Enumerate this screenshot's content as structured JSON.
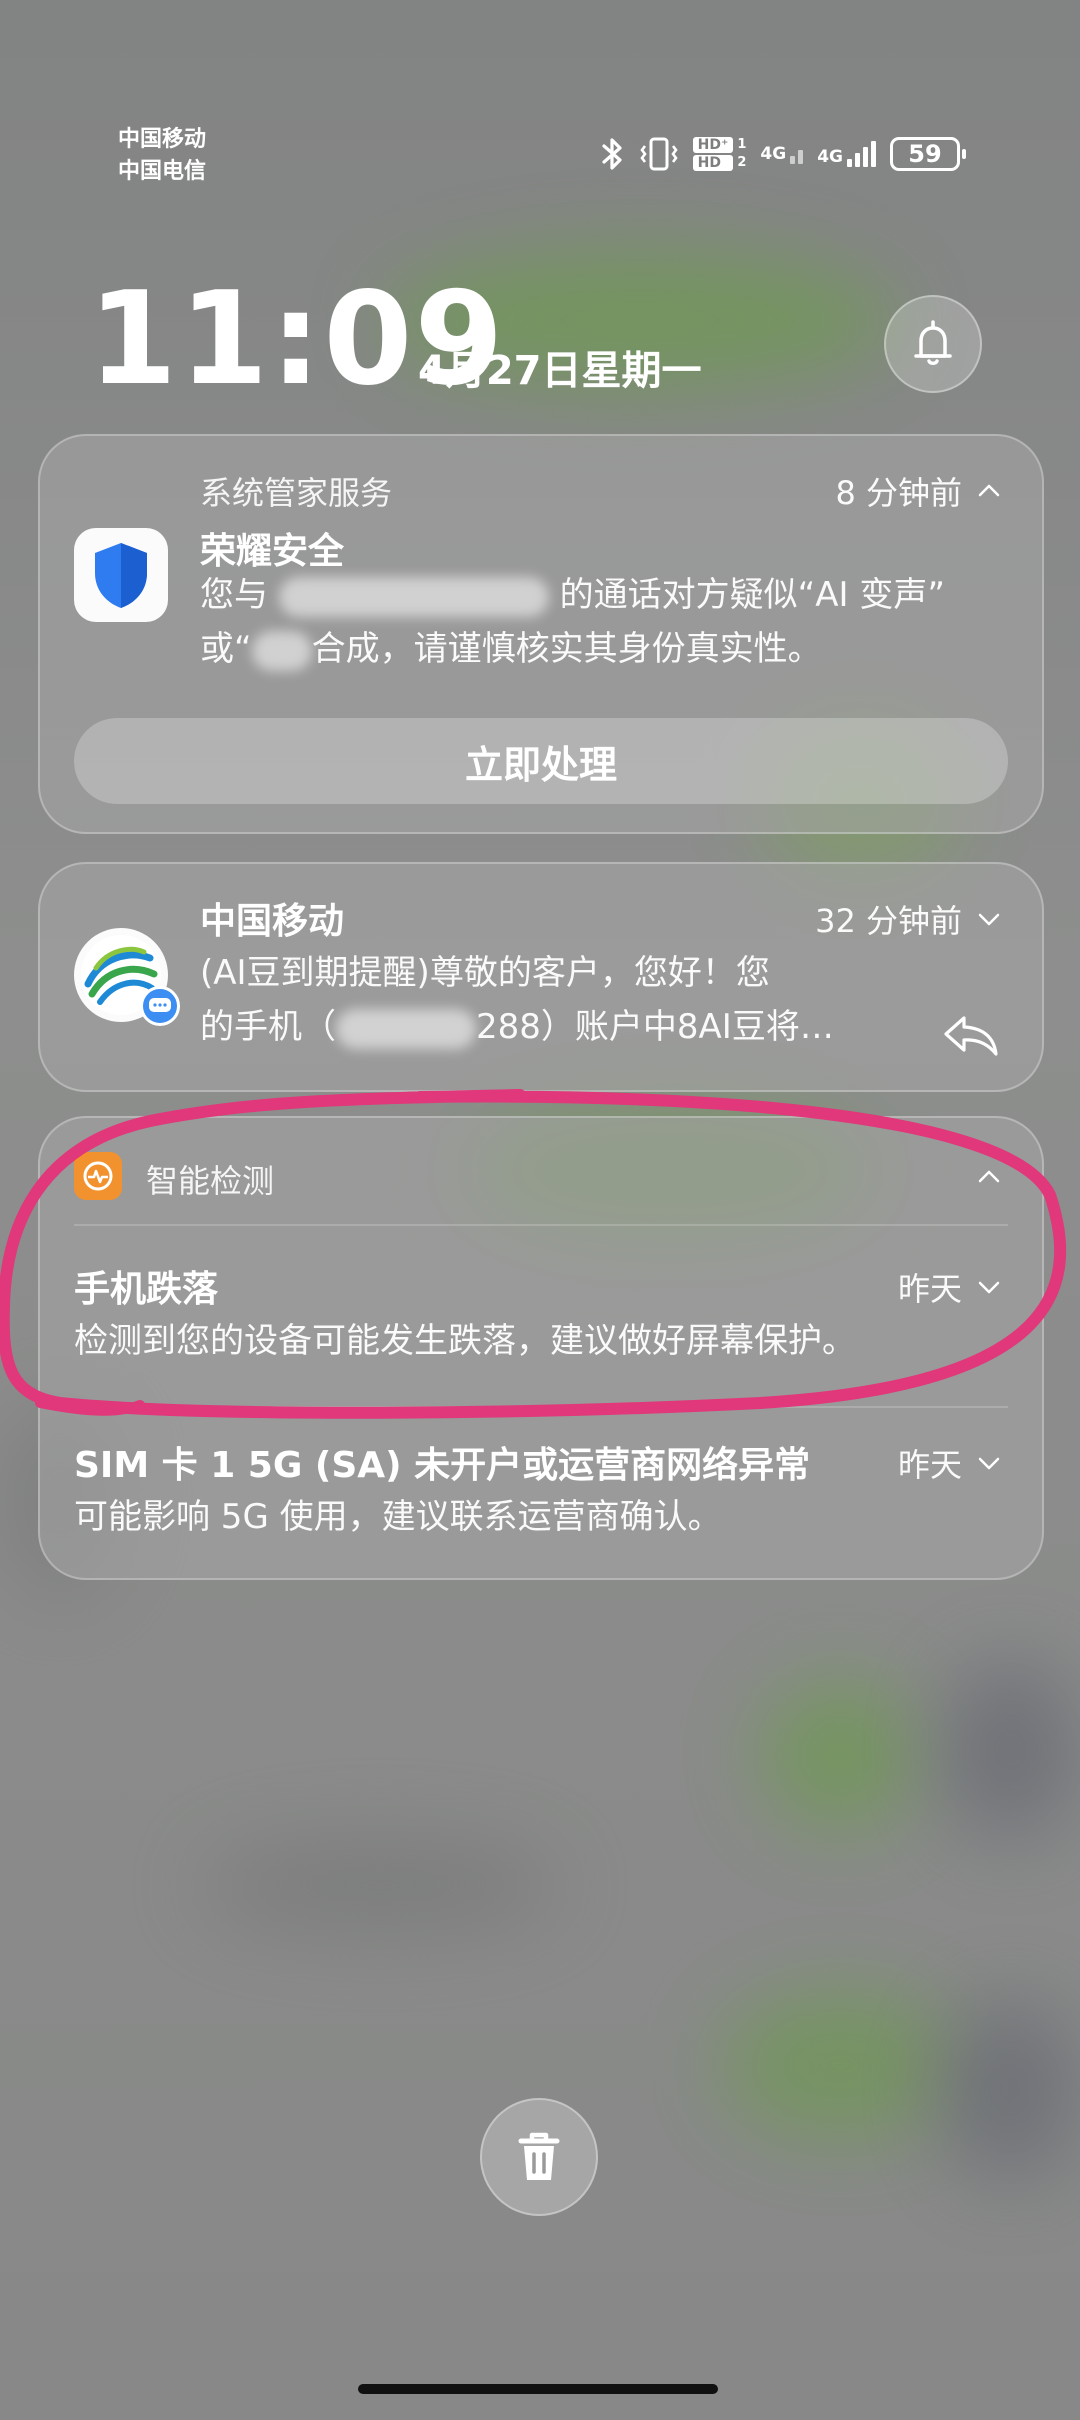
{
  "status_bar": {
    "carrier_1": "中国移动",
    "carrier_2": "中国电信",
    "hd_1": "HD⁺",
    "hd_2": "HD",
    "sim1_index": "1",
    "sim2_index": "2",
    "network_1": "4G",
    "network_2": "4G",
    "battery": "59",
    "icons": [
      "bluetooth-icon",
      "vibrate-icon",
      "signal-icon",
      "battery-icon"
    ]
  },
  "lockscreen": {
    "time": "11:09",
    "date": "4月27日星期一"
  },
  "notifications": [
    {
      "source": "系统管家服务",
      "time": "8 分钟前",
      "title": "荣耀安全",
      "body_prefix": "您与",
      "body_middle": "的通话对方疑似“AI 变声”",
      "body_line2_prefix": "或“",
      "body_line2_tail": "合成，请谨慎核实其身份真实性。",
      "action": "立即处理",
      "icon": "shield-icon"
    },
    {
      "title": "中国移动",
      "time": "32 分钟前",
      "body_line1": "(AI豆到期提醒)尊敬的客户，您好！您",
      "body_line2_prefix": "的手机（",
      "body_line2_tail": "288）账户中8AI豆将…",
      "icon": "china-mobile-icon"
    },
    {
      "source": "智能检测",
      "icon": "smart-detection-icon",
      "items": [
        {
          "title": "手机跌落",
          "time": "昨天",
          "body": "检测到您的设备可能发生跌落，建议做好屏幕保护。"
        },
        {
          "title": "SIM 卡 1 5G (SA) 未开户或运营商网络异常",
          "time": "昨天",
          "body": "可能影响 5G 使用，建议联系运营商确认。"
        }
      ]
    }
  ],
  "colors": {
    "annotation": "#e0387a",
    "shield": "#2f7bf0"
  }
}
